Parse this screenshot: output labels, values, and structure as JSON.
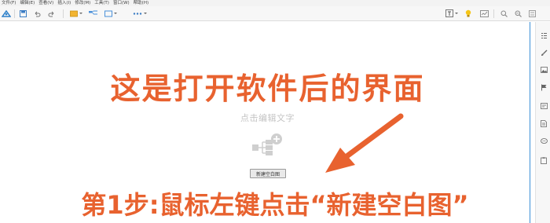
{
  "menu": [
    "文件(F)",
    "编辑(E)",
    "查看(V)",
    "插入(I)",
    "修改(M)",
    "工具(T)",
    "窗口(W)",
    "帮助(H)"
  ],
  "canvas": {
    "hint_text": "点击编辑文字",
    "new_blank_button": "新建空白图"
  },
  "overlay": {
    "top_caption": "这是打开软件后的界面",
    "bottom_caption": "第1步:鼠标左键点击“新建空白图”"
  },
  "icons": {
    "toolbar": [
      "app-logo-icon",
      "save-icon",
      "undo-icon",
      "redo-icon",
      "theme-icon",
      "layout-icon",
      "style-icon",
      "more-icon",
      "topic-icon",
      "idea-icon",
      "presentation-icon",
      "search-icon",
      "zoom-icon",
      "settings-icon"
    ],
    "right_panel": [
      "outline-icon",
      "brush-icon",
      "image-icon",
      "flag-icon",
      "note-icon",
      "document-icon",
      "comment-icon",
      "task-icon"
    ]
  },
  "colors": {
    "accent": "#e8622f",
    "selection_border": "#3b8fd8",
    "hint_gray": "#c4c4c4"
  }
}
